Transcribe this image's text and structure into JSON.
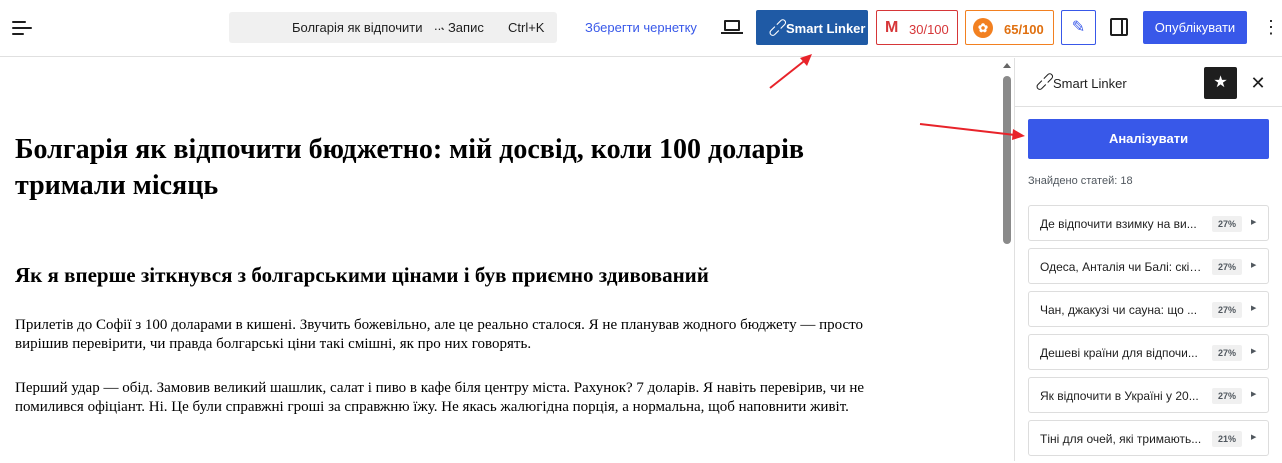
{
  "toolbar": {
    "command_title": "Болгарія як відпочити",
    "command_dots": "...",
    "command_type": "· Запис",
    "command_shortcut": "Ctrl+K",
    "save_draft": "Зберегти чернетку",
    "smart_linker": "Smart Linker",
    "score_red": "30/100",
    "score_orange": "65/100",
    "publish": "Опублікувати"
  },
  "post": {
    "title": "Болгарія як відпочити бюджетно: мій досвід, коли 100 доларів тримали місяць",
    "heading": "Як я вперше зіткнувся з болгарськими цінами і був приємно здивований",
    "paragraph1": "Прилетів до Софії з 100 доларами в кишені. Звучить божевільно, але це реально сталося. Я не планував жодного бюджету — просто вирішив перевірити, чи правда болгарські ціни такі смішні, як про них говорять.",
    "paragraph2": "Перший удар — обід. Замовив великий шашлик, салат і пиво в кафе біля центру міста. Рахунок? 7 доларів. Я навіть перевірив, чи не помилився офіціант. Ні. Це були справжні гроші за справжню їжу. Не якась жалюгідна порція, а нормальна, щоб наповнити живіт."
  },
  "panel": {
    "title": "Smart Linker",
    "analyze": "Аналізувати",
    "found": "Знайдено статей: 18",
    "items": [
      {
        "label": "Де відпочити взимку на ви...",
        "score": "27%"
      },
      {
        "label": "Одеса, Анталія чи Балі: скіл...",
        "score": "27%"
      },
      {
        "label": "Чан, джакузі чи сауна: що ...",
        "score": "27%"
      },
      {
        "label": "Дешеві країни для відпочи...",
        "score": "27%"
      },
      {
        "label": "Як відпочити в Україні у 20...",
        "score": "27%"
      },
      {
        "label": "Тіні для очей, які тримають...",
        "score": "21%"
      }
    ]
  },
  "colors": {
    "accent": "#3858e9",
    "smart_linker": "#1f5aa5",
    "score_red": "#d63638",
    "score_orange": "#f28020",
    "annotation_arrow": "#e8232a"
  },
  "icons": [
    "menu-icon",
    "laptop-icon",
    "link-icon",
    "seo-icon",
    "readability-icon",
    "magic-wand-icon",
    "sidebar-toggle-icon",
    "kebab-icon",
    "star-icon",
    "close-icon",
    "caret-right-icon"
  ]
}
